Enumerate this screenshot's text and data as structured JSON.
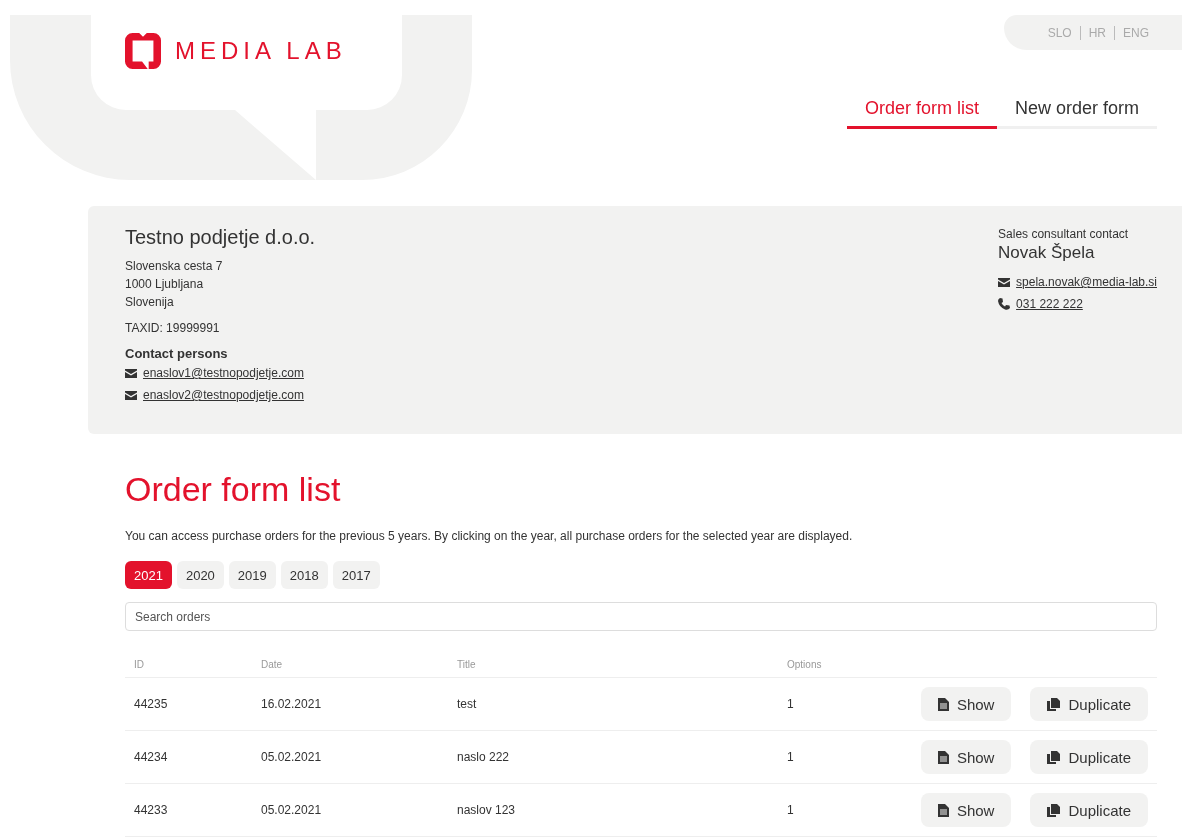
{
  "logo": {
    "text": "MEDIA LAB"
  },
  "languages": [
    {
      "label": "SLO",
      "selected": false
    },
    {
      "label": "HR",
      "selected": false
    },
    {
      "label": "ENG",
      "selected": false
    }
  ],
  "nav": [
    {
      "label": "Order form list",
      "selected": true
    },
    {
      "label": "New order form",
      "selected": false
    }
  ],
  "company": {
    "name": "Testno podjetje d.o.o.",
    "address": [
      "Slovenska cesta 7",
      "1000 Ljubljana",
      "Slovenija"
    ],
    "taxid": "TAXID: 19999991",
    "contacts_heading": "Contact persons",
    "contacts": [
      "enaslov1@testnopodjetje.com",
      "enaslov2@testnopodjetje.com"
    ]
  },
  "consultant": {
    "heading": "Sales consultant contact",
    "name": "Novak Špela",
    "email": "spela.novak@media-lab.si",
    "phone": "031 222 222"
  },
  "page_title": "Order form list",
  "description": "You can access purchase orders for the previous 5 years. By clicking on the year, all purchase orders for the selected year are displayed.",
  "years": [
    {
      "label": "2021",
      "selected": true
    },
    {
      "label": "2020",
      "selected": false
    },
    {
      "label": "2019",
      "selected": false
    },
    {
      "label": "2018",
      "selected": false
    },
    {
      "label": "2017",
      "selected": false
    }
  ],
  "search": {
    "placeholder": "Search orders"
  },
  "table": {
    "columns": [
      "ID",
      "Date",
      "Title",
      "Options"
    ],
    "rows": [
      {
        "id": "44235",
        "date": "16.02.2021",
        "title": "test",
        "options": "1",
        "actions": [
          "Show",
          "Duplicate"
        ]
      },
      {
        "id": "44234",
        "date": "05.02.2021",
        "title": "naslo 222",
        "options": "1",
        "actions": [
          "Show",
          "Duplicate"
        ]
      },
      {
        "id": "44233",
        "date": "05.02.2021",
        "title": "naslov 123",
        "options": "1",
        "actions": [
          "Show",
          "Duplicate"
        ]
      }
    ]
  }
}
